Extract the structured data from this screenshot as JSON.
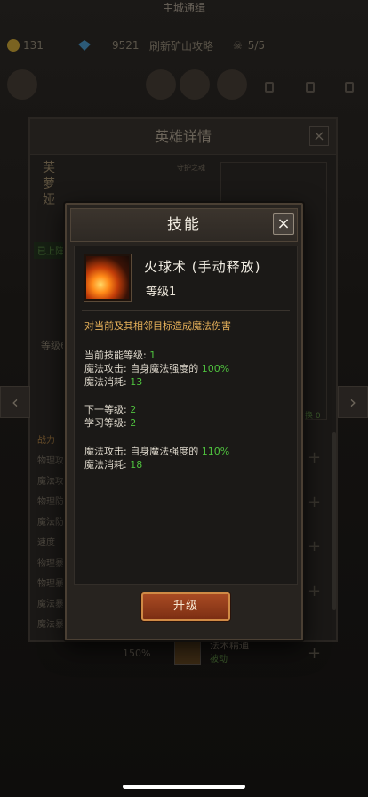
{
  "background": {
    "top_title": "主城通缉",
    "gold": "131",
    "gem": "9521",
    "resource_text": "刷新矿山攻略",
    "resource_right": "5/5",
    "hero_panel_title": "英雄详情",
    "hero_name": "芙萝娅",
    "guardian_label": "守护之魂",
    "battle_tag": "已上阵",
    "level_label": "等级6",
    "stats_header": "战力",
    "stat_rows": [
      "物理攻",
      "魔法攻",
      "物理防",
      "魔法防",
      "速度",
      "物理暴",
      "物理暴",
      "魔法暴",
      "魔法暴伤"
    ],
    "stat_pct": "150%",
    "equip_hint": "更换 0",
    "skill_peek_name": "法术精通",
    "skill_peek_sub": "被动",
    "left_arrow": "‹",
    "right_arrow": "›"
  },
  "modal": {
    "title": "技能",
    "close": "×",
    "skill": {
      "name": "火球术 (手动释放)",
      "level_tag": "等级1",
      "icon": "fireball-icon",
      "description": "对当前及其相邻目标造成魔法伤害"
    },
    "current": {
      "level_label": "当前技能等级: ",
      "level_value": "1",
      "attack_label": "魔法攻击: 自身魔法强度的 ",
      "attack_value": "100%",
      "cost_label": "魔法消耗: ",
      "cost_value": "13"
    },
    "next": {
      "level_label": "下一等级: ",
      "level_value": "2",
      "learn_label": "学习等级: ",
      "learn_value": "2",
      "attack_label": "魔法攻击: 自身魔法强度的 ",
      "attack_value": "110%",
      "cost_label": "魔法消耗: ",
      "cost_value": "18"
    },
    "upgrade_button": "升级"
  },
  "colors": {
    "value_green": "#4fc23e",
    "description_gold": "#e6b15a",
    "button_orange": "#a94b23"
  }
}
